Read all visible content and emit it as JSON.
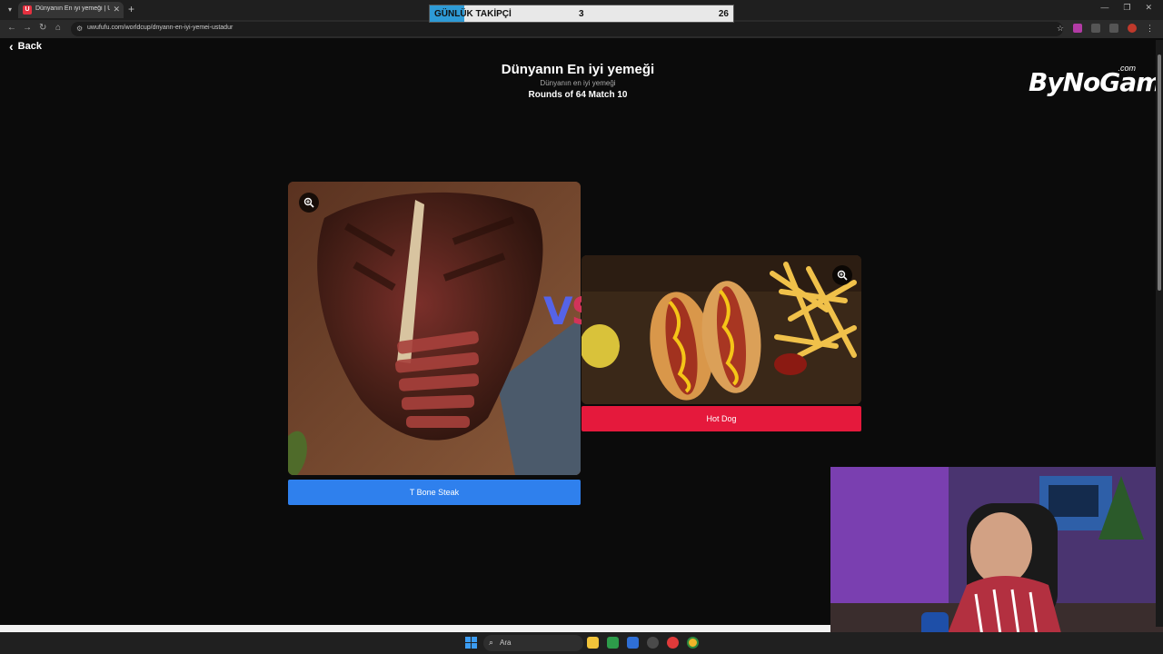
{
  "browser": {
    "tab_title": "Dünyanın En iyi yemeği | UwUf",
    "tab_favicon": "U",
    "url": "uwufufu.com/worldcup/dnyann-en-iyi-yemei-ustadur"
  },
  "overlay": {
    "label": "GÜNLÜK TAKİPÇİ",
    "current": "3",
    "goal": "26",
    "progress_fraction": 0.115,
    "fill_color": "#2e9bd6"
  },
  "page": {
    "back_label": "Back",
    "title": "Dünyanın En iyi yemeği",
    "subtitle": "Dünyanın en iyi yemeği",
    "round_info": "Rounds of 64 Match 10",
    "brand": "ByNoGame",
    "brand_suffix": ".com"
  },
  "candidates": [
    {
      "name": "T Bone Steak",
      "color": "#2f80ed",
      "icon": "zoom-icon"
    },
    {
      "name": "Hot Dog",
      "color": "#e5193c",
      "icon": "zoom-icon"
    }
  ],
  "vs": {
    "v": "V",
    "s": "S"
  },
  "taskbar": {
    "search_placeholder": "Ara"
  }
}
